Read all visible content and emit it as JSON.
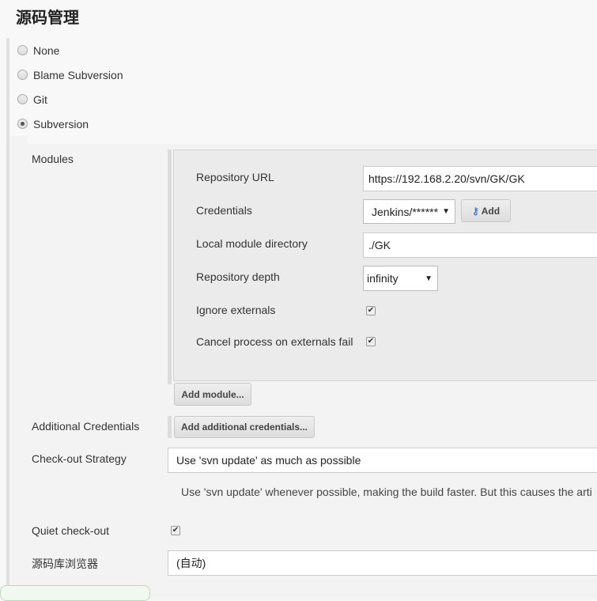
{
  "section_title": "源码管理",
  "scm_options": [
    {
      "label": "None",
      "selected": false
    },
    {
      "label": "Blame Subversion",
      "selected": false
    },
    {
      "label": "Git",
      "selected": false
    },
    {
      "label": "Subversion",
      "selected": true
    }
  ],
  "modules": {
    "label": "Modules",
    "repository_url_label": "Repository URL",
    "repository_url": "https://192.168.2.20/svn/GK/GK",
    "credentials_label": "Credentials",
    "credentials_value": "Jenkins/******",
    "add_label": "Add",
    "local_dir_label": "Local module directory",
    "local_dir": "./GK",
    "depth_label": "Repository depth",
    "depth_value": "infinity",
    "ignore_externals_label": "Ignore externals",
    "ignore_externals": true,
    "cancel_externals_label": "Cancel process on externals fail",
    "cancel_externals": true,
    "add_module_label": "Add module..."
  },
  "additional_credentials": {
    "label": "Additional Credentials",
    "button": "Add additional credentials..."
  },
  "checkout_strategy": {
    "label": "Check-out Strategy",
    "value": "Use 'svn update' as much as possible",
    "help": "Use 'svn update' whenever possible, making the build faster. But this causes the arti"
  },
  "quiet_checkout": {
    "label": "Quiet check-out",
    "checked": true
  },
  "repo_browser": {
    "label": "源码库浏览器",
    "value": "(自动)"
  }
}
